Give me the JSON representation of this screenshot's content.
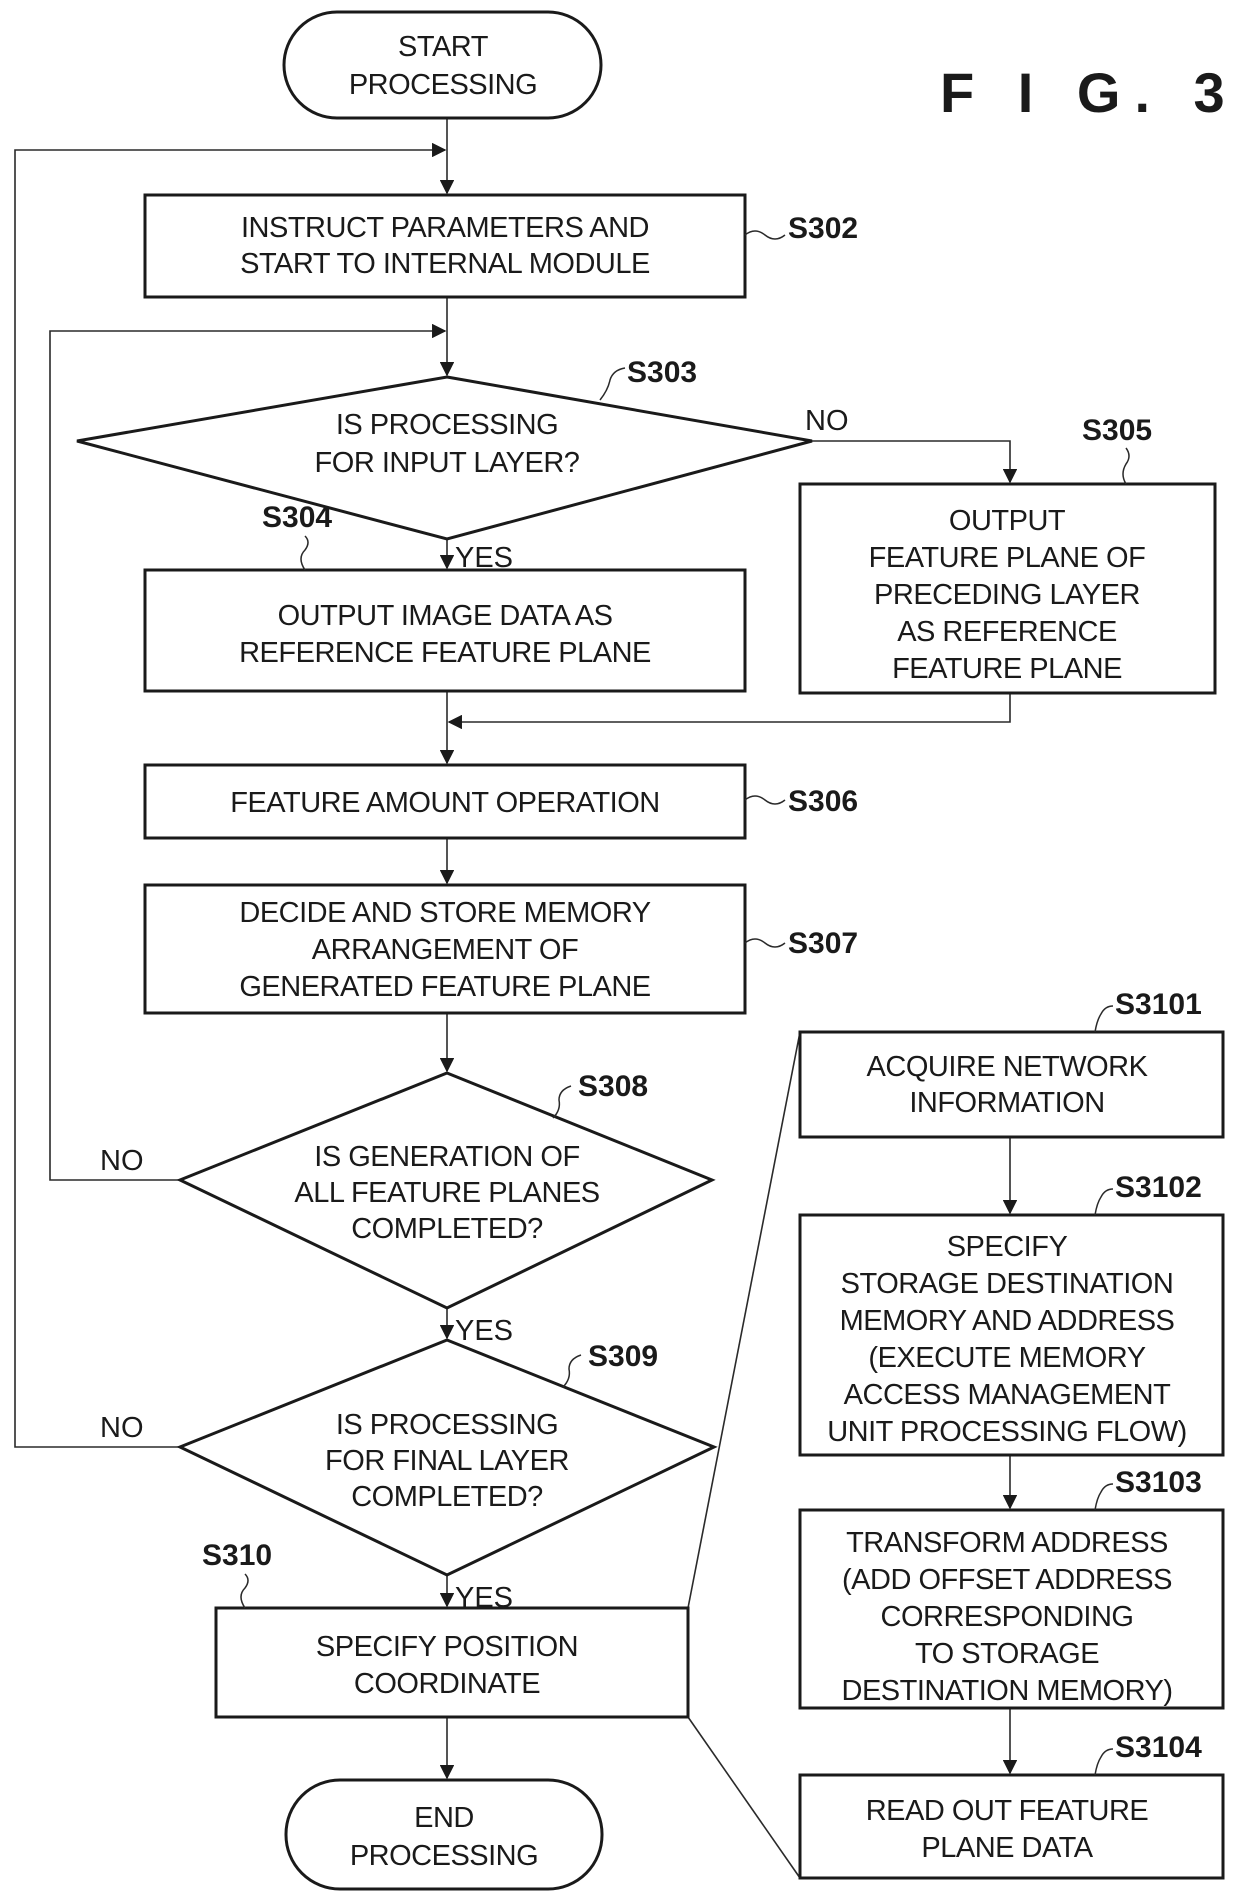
{
  "figure_label": "F I G.  3",
  "start": {
    "lines": [
      "START",
      "PROCESSING"
    ]
  },
  "end": {
    "lines": [
      "END",
      "PROCESSING"
    ]
  },
  "steps": {
    "s302": {
      "id": "S302",
      "lines": [
        "INSTRUCT PARAMETERS AND",
        "START TO INTERNAL MODULE"
      ]
    },
    "s303": {
      "id": "S303",
      "lines": [
        "IS PROCESSING",
        "FOR INPUT LAYER?"
      ]
    },
    "s304": {
      "id": "S304",
      "lines": [
        "OUTPUT IMAGE DATA AS",
        "REFERENCE FEATURE PLANE"
      ]
    },
    "s305": {
      "id": "S305",
      "lines": [
        "OUTPUT",
        "FEATURE PLANE OF",
        "PRECEDING LAYER",
        "AS REFERENCE",
        "FEATURE PLANE"
      ]
    },
    "s306": {
      "id": "S306",
      "lines": [
        "FEATURE AMOUNT OPERATION"
      ]
    },
    "s307": {
      "id": "S307",
      "lines": [
        "DECIDE AND STORE MEMORY",
        "ARRANGEMENT OF",
        "GENERATED FEATURE PLANE"
      ]
    },
    "s308": {
      "id": "S308",
      "lines": [
        "IS GENERATION OF",
        "ALL FEATURE PLANES",
        "COMPLETED?"
      ]
    },
    "s309": {
      "id": "S309",
      "lines": [
        "IS PROCESSING",
        "FOR FINAL LAYER",
        "COMPLETED?"
      ]
    },
    "s310": {
      "id": "S310",
      "lines": [
        "SPECIFY POSITION",
        "COORDINATE"
      ]
    },
    "s3101": {
      "id": "S3101",
      "lines": [
        "ACQUIRE NETWORK",
        "INFORMATION"
      ]
    },
    "s3102": {
      "id": "S3102",
      "lines": [
        "SPECIFY",
        "STORAGE DESTINATION",
        "MEMORY AND ADDRESS",
        "(EXECUTE MEMORY",
        "ACCESS MANAGEMENT",
        "UNIT PROCESSING FLOW)"
      ]
    },
    "s3103": {
      "id": "S3103",
      "lines": [
        "TRANSFORM ADDRESS",
        "(ADD OFFSET ADDRESS",
        "CORRESPONDING",
        "TO STORAGE",
        "DESTINATION MEMORY)"
      ]
    },
    "s3104": {
      "id": "S3104",
      "lines": [
        "READ OUT FEATURE",
        "PLANE DATA"
      ]
    }
  },
  "branch_labels": {
    "s303_yes": "YES",
    "s303_no": "NO",
    "s308_yes": "YES",
    "s308_no": "NO",
    "s309_yes": "YES",
    "s309_no": "NO"
  }
}
